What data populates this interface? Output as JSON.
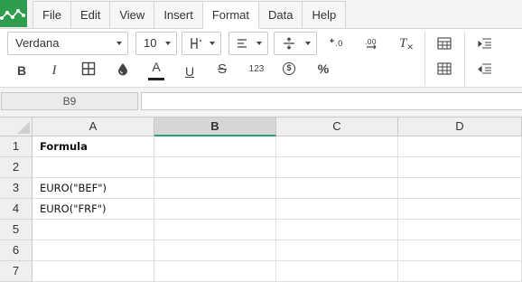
{
  "menu": {
    "items": [
      "File",
      "Edit",
      "View",
      "Insert",
      "Format",
      "Data",
      "Help"
    ],
    "active": "Format"
  },
  "toolbar": {
    "font_family": "Verdana",
    "font_size": "10",
    "number_format_label": "123",
    "currency_symbol": "$",
    "percent_symbol": "%",
    "bold_label": "B",
    "italic_label": "I",
    "text_color_label": "A",
    "underline_label": "U",
    "strike_label": "S",
    "clear_format_label": "T"
  },
  "formula_bar": {
    "cell_ref": "B9",
    "value": ""
  },
  "sheet": {
    "columns": [
      "A",
      "B",
      "C",
      "D"
    ],
    "active_column": "B",
    "rows": [
      "1",
      "2",
      "3",
      "4",
      "5",
      "6",
      "7"
    ],
    "cells": {
      "A1": "Formula",
      "A3": "EURO(\"BEF\")",
      "A4": "EURO(\"FRF\")"
    }
  },
  "colors": {
    "brand_green": "#2e9d4e",
    "active_column_underline": "#2aa070"
  }
}
